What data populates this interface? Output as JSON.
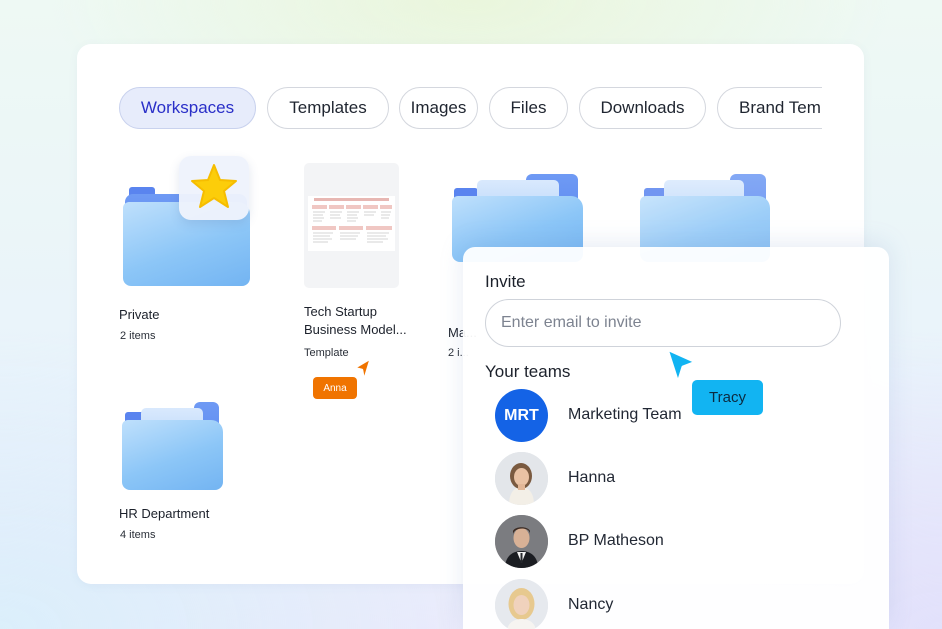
{
  "tabs": [
    {
      "label": "Workspaces",
      "active": true
    },
    {
      "label": "Templates",
      "active": false
    },
    {
      "label": "Images",
      "active": false
    },
    {
      "label": "Files",
      "active": false
    },
    {
      "label": "Downloads",
      "active": false
    },
    {
      "label": "Brand Templates",
      "active": false
    }
  ],
  "items": [
    {
      "title": "Private",
      "subtitle": "2 items",
      "icon": "starred-folder-icon"
    },
    {
      "title": "Tech Startup Business Model...",
      "subtitle": "Template",
      "icon": "document-thumbnail"
    },
    {
      "title": "Ma...",
      "subtitle": "2 i...",
      "icon": "folder-icon"
    },
    {
      "title": "HR Department",
      "subtitle": "4 items",
      "icon": "folder-icon"
    }
  ],
  "cursors": {
    "anna": {
      "name": "Anna",
      "color": "#f07400"
    },
    "tracy": {
      "name": "Tracy",
      "color": "#12b4f2"
    }
  },
  "invite": {
    "title": "Invite",
    "placeholder": "Enter email to invite",
    "teams_title": "Your teams",
    "members": [
      {
        "name": "Marketing Team",
        "initials": "MRT",
        "color": "#1463e6"
      },
      {
        "name": "Hanna",
        "initials": "",
        "color": ""
      },
      {
        "name": "BP Matheson",
        "initials": "",
        "color": ""
      },
      {
        "name": "Nancy",
        "initials": "",
        "color": ""
      }
    ]
  },
  "colors": {
    "accent": "#2a2fc8",
    "active_tab_bg": "#e7ecfb",
    "folder_blue": "#5a84ef",
    "star": "#fccd0a"
  }
}
